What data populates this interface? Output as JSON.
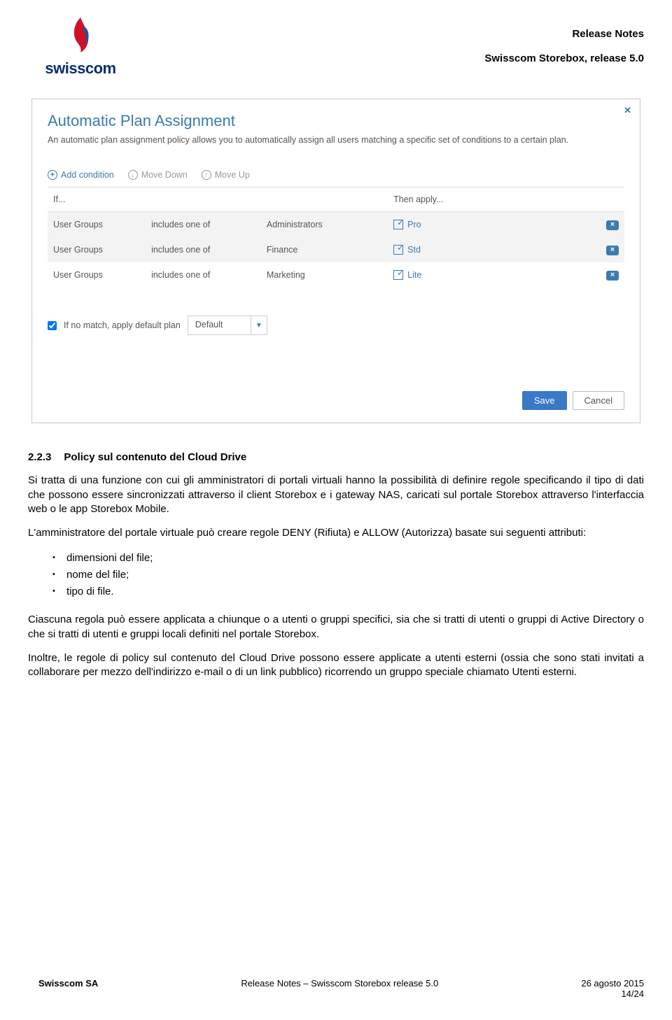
{
  "header": {
    "logo_text": "swisscom",
    "release_notes": "Release Notes",
    "subtitle": "Swisscom Storebox, release 5.0"
  },
  "dialog": {
    "title": "Automatic Plan Assignment",
    "description": "An automatic plan assignment policy allows you to automatically assign all users matching a specific set of conditions to a certain plan.",
    "toolbar": {
      "add": "Add condition",
      "down": "Move Down",
      "up": "Move Up"
    },
    "table": {
      "if": "If...",
      "then": "Then apply...",
      "rows": [
        {
          "col1": "User Groups",
          "col2": "includes one of",
          "col3": "Administrators",
          "plan": "Pro"
        },
        {
          "col1": "User Groups",
          "col2": "includes one of",
          "col3": "Finance",
          "plan": "Std"
        },
        {
          "col1": "User Groups",
          "col2": "includes one of",
          "col3": "Marketing",
          "plan": "Lite"
        }
      ]
    },
    "default_label": "If no match, apply default plan",
    "default_value": "Default",
    "save": "Save",
    "cancel": "Cancel"
  },
  "section": {
    "number": "2.2.3",
    "title": "Policy sul contenuto del Cloud Drive",
    "p1": "Si tratta di una funzione con cui gli amministratori di portali virtuali hanno la possibilità di definire regole specificando il tipo di dati che possono essere sincronizzati attraverso il client Storebox e i gateway NAS, caricati sul portale Storebox attraverso l'interfaccia web o le app Storebox Mobile.",
    "p2": "L'amministratore del portale virtuale può creare regole DENY (Rifiuta) e ALLOW (Autorizza) basate sui seguenti attributi:",
    "bullets": [
      "dimensioni del file;",
      "nome del file;",
      "tipo di file."
    ],
    "p3": "Ciascuna regola può essere applicata a chiunque o a utenti o gruppi specifici, sia che si tratti di utenti o gruppi di Active Directory o che si tratti di utenti e gruppi locali definiti nel portale Storebox.",
    "p4": "Inoltre, le regole di policy sul contenuto del Cloud Drive possono essere applicate a utenti esterni (ossia che sono stati invitati a collaborare per mezzo dell'indirizzo e-mail o di un link pubblico) ricorrendo un gruppo speciale chiamato Utenti esterni."
  },
  "footer": {
    "left": "Swisscom SA",
    "center": "Release Notes – Swisscom Storebox release 5.0",
    "date": "26 agosto 2015",
    "page": "14/24"
  }
}
